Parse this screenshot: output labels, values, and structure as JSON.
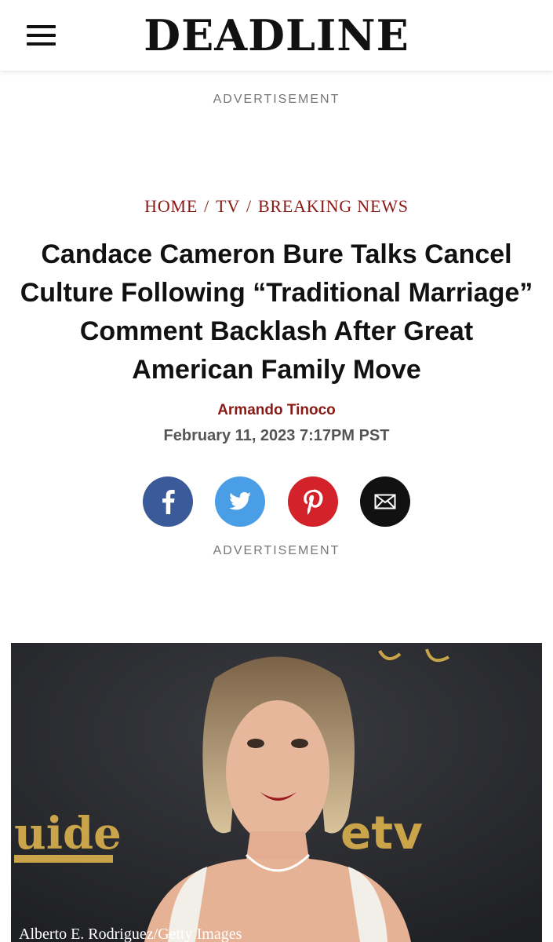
{
  "header": {
    "logo": "DEADLINE",
    "menu_icon": "hamburger-menu-icon"
  },
  "ads": {
    "label_top": "ADVERTISEMENT",
    "label_bottom": "ADVERTISEMENT"
  },
  "breadcrumb": {
    "items": [
      "HOME",
      "TV",
      "BREAKING NEWS"
    ],
    "separator": "/"
  },
  "article": {
    "headline": "Candace Cameron Bure Talks Cancel Culture Following “Traditional Marriage” Comment Backlash After Great American Family Move",
    "author": "Armando Tinoco",
    "date": "February 11, 2023 7:17PM PST"
  },
  "share": {
    "buttons": [
      {
        "icon": "facebook-icon",
        "color": "#3b5a9a"
      },
      {
        "icon": "twitter-icon",
        "color": "#4a9ee6"
      },
      {
        "icon": "pinterest-icon",
        "color": "#d3222a"
      },
      {
        "icon": "email-icon",
        "color": "#111111"
      }
    ]
  },
  "hero": {
    "caption": "Alberto E. Rodriguez/Getty Images"
  },
  "colors": {
    "accent": "#8a1a16",
    "text": "#111111",
    "muted": "#777777"
  }
}
